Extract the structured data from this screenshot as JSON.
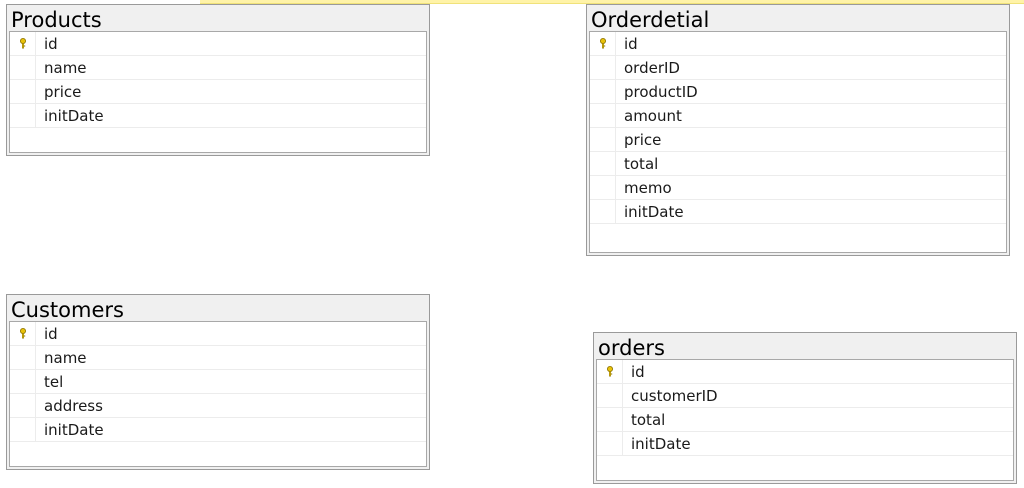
{
  "colors": {
    "table_header_bg": "#f0f0f0",
    "table_border": "#9a9a9a",
    "key_icon": "#e8c20a",
    "top_strip": "#fff3a8"
  },
  "tables": {
    "products": {
      "title": "Products",
      "columns": [
        {
          "name": "id",
          "primary_key": true
        },
        {
          "name": "name",
          "primary_key": false
        },
        {
          "name": "price",
          "primary_key": false
        },
        {
          "name": "initDate",
          "primary_key": false
        }
      ]
    },
    "orderdetial": {
      "title": "Orderdetial",
      "columns": [
        {
          "name": "id",
          "primary_key": true
        },
        {
          "name": "orderID",
          "primary_key": false
        },
        {
          "name": "productID",
          "primary_key": false
        },
        {
          "name": "amount",
          "primary_key": false
        },
        {
          "name": "price",
          "primary_key": false
        },
        {
          "name": "total",
          "primary_key": false
        },
        {
          "name": "memo",
          "primary_key": false
        },
        {
          "name": "initDate",
          "primary_key": false
        }
      ]
    },
    "customers": {
      "title": "Customers",
      "columns": [
        {
          "name": "id",
          "primary_key": true
        },
        {
          "name": "name",
          "primary_key": false
        },
        {
          "name": "tel",
          "primary_key": false
        },
        {
          "name": "address",
          "primary_key": false
        },
        {
          "name": "initDate",
          "primary_key": false
        }
      ]
    },
    "orders": {
      "title": "orders",
      "columns": [
        {
          "name": "id",
          "primary_key": true
        },
        {
          "name": "customerID",
          "primary_key": false
        },
        {
          "name": "total",
          "primary_key": false
        },
        {
          "name": "initDate",
          "primary_key": false
        }
      ]
    }
  }
}
